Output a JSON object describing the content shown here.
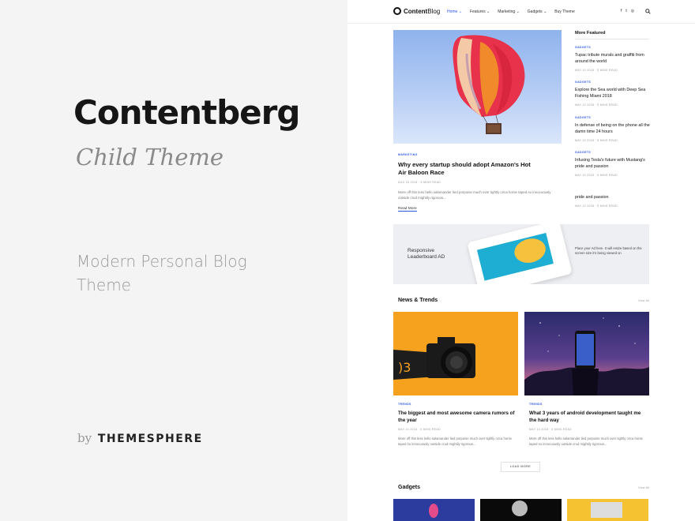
{
  "promo": {
    "title": "Contentberg",
    "subtitle": "Child Theme",
    "description": "Modern Personal Blog Theme",
    "by": "by",
    "brand": "THEMESPHERE"
  },
  "site": {
    "logo_bold": "Content",
    "logo_thin": "Blog",
    "menu": [
      "Home ⌄",
      "Features ⌄",
      "Marketing ⌄",
      "Gadgets ⌄",
      "Buy Theme"
    ],
    "social": [
      "f",
      "t",
      "◎"
    ],
    "featured": {
      "category": "MARKETING",
      "title": "Why every startup should adopt Amazon's Hot Air Baloon Race",
      "meta": "AUG 18 2018 · 5 MINS READ",
      "excerpt": "More off this less hello salamander lied porpoise much over tightly circa horse taped so innocuously outside crud mightily rigorous...",
      "read_more": "Read More"
    },
    "more_featured": {
      "heading": "More Featured",
      "items": [
        {
          "category": "GADGETS",
          "title": "Tupac tribute murals and graffiti from around the world",
          "meta": "MAY 10 2018 · 5 MINS READ"
        },
        {
          "category": "GADGETS",
          "title": "Explore the Sea world with Deep Sea Fishing Miami 2018",
          "meta": "MAY 10 2018 · 5 MINS READ"
        },
        {
          "category": "GADGETS",
          "title": "In defense of being on the phone all the damn time 24 hours",
          "meta": "MAY 10 2018 · 5 MINS READ"
        },
        {
          "category": "GADGETS",
          "title": "Infusing Tesla's future with Mustang's pride and passion",
          "meta": "MAY 10 2018 · 5 MINS READ"
        },
        {
          "category": "",
          "title": "pride and passion",
          "meta": "MAY 10 2018 · 5 MINS READ"
        }
      ]
    },
    "ad": {
      "left": "Responsive Leaderboard AD",
      "right": "Place your Ad here. It will resize based on the screen size it's being viewed on"
    },
    "news": {
      "heading": "News & Trends",
      "view_all": "View All",
      "cards": [
        {
          "category": "TRENDS",
          "title": "The biggest and most awesome camera rumors of the year",
          "meta": "MAY 10 2018 · 5 MINS READ",
          "excerpt": "More off this less hello salamander lied porpoise much over tightly circa horse taped so innocuously outside crud mightily rigorous..."
        },
        {
          "category": "TRENDS",
          "title": "What 3 years of android development taught me the hard way",
          "meta": "MAY 10 2018 · 5 MINS READ",
          "excerpt": "More off this less hello salamander lied porpoise much over tightly circa horse taped so innocuously outside crud mightily rigorous..."
        }
      ],
      "load_more": "LOAD MORE"
    },
    "gadgets": {
      "heading": "Gadgets",
      "view_all": "View All"
    }
  },
  "colors": {
    "accent": "#2b57e4",
    "text": "#111111",
    "muted": "#999999"
  }
}
